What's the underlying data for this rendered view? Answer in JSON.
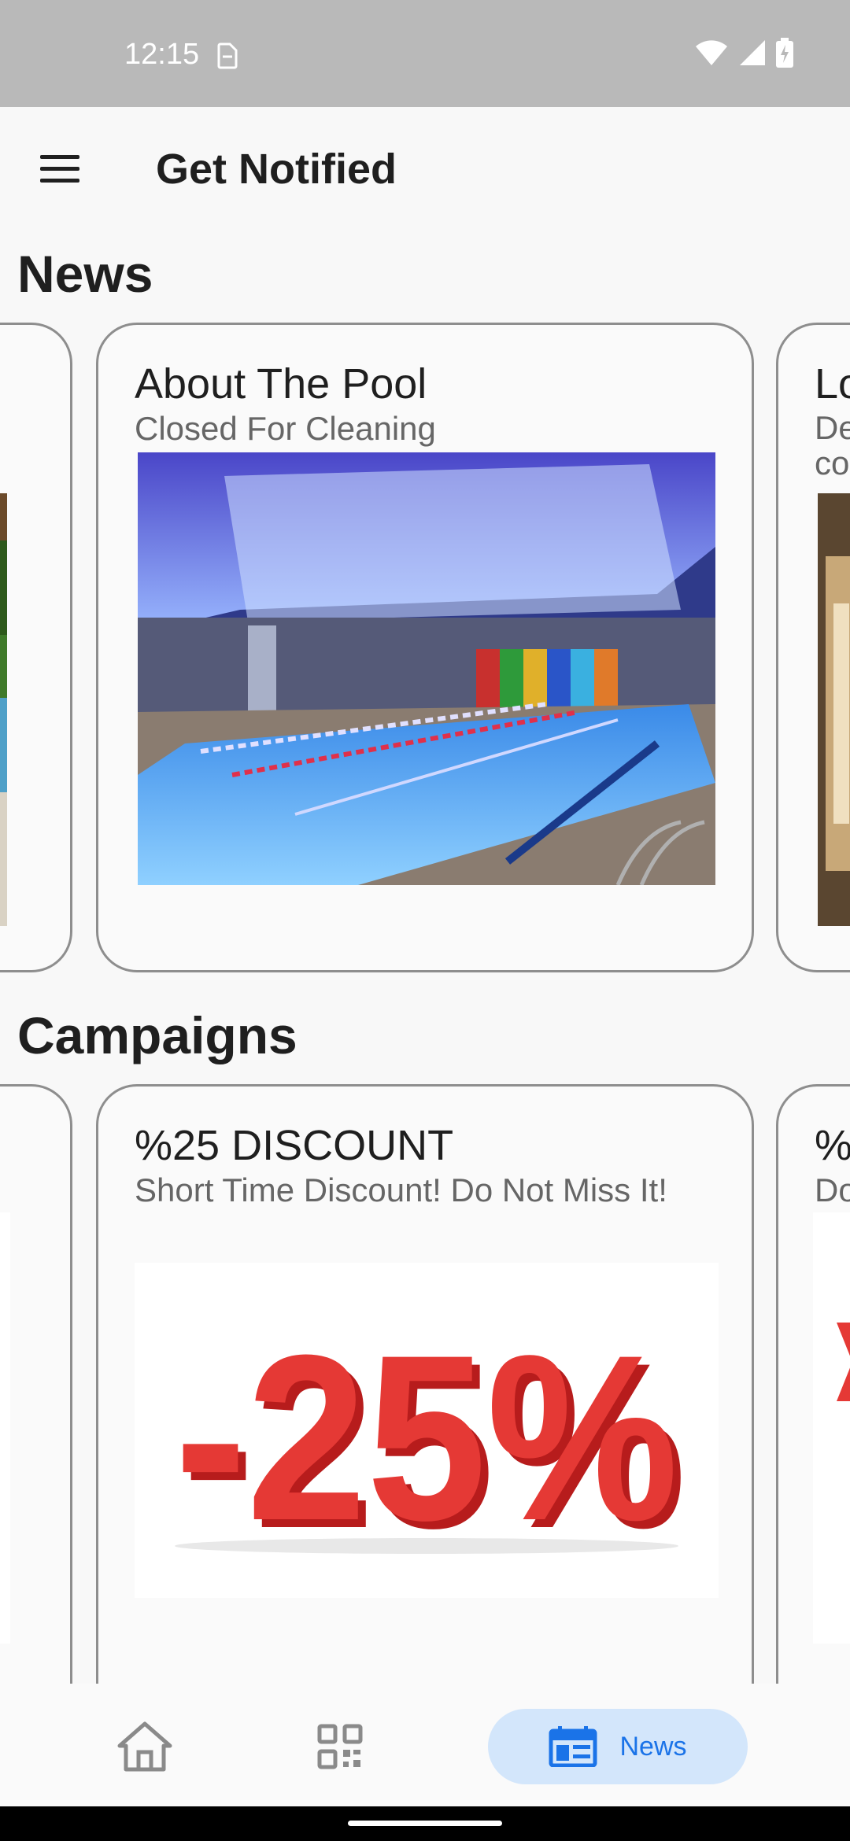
{
  "status": {
    "time": "12:15"
  },
  "app_bar": {
    "title": "Get Notified"
  },
  "sections": {
    "news": {
      "title": "News",
      "cards": [
        {
          "title": "About The Pool",
          "subtitle": "Closed For Cleaning"
        },
        {
          "title": "Lo",
          "subtitle": "De co"
        }
      ]
    },
    "campaigns": {
      "title": "Campaigns",
      "cards": [
        {
          "title": "%25 DISCOUNT",
          "subtitle": "Short Time Discount! Do Not Miss It!",
          "graphic_text": "-25%"
        },
        {
          "title": "%(",
          "subtitle": "Do"
        }
      ]
    }
  },
  "bottom_nav": {
    "items": [
      {
        "icon": "home-icon"
      },
      {
        "icon": "qr-code-icon"
      },
      {
        "icon": "news-icon",
        "label": "News",
        "active": true
      }
    ]
  },
  "colors": {
    "accent": "#1a73e8",
    "active_pill": "#d3e6fb",
    "discount_red": "#e53935"
  }
}
